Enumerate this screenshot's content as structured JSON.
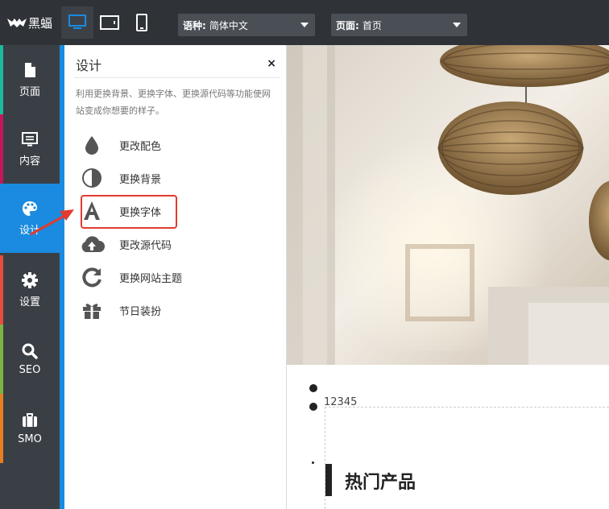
{
  "topbar": {
    "logo_text": "黑蝠",
    "device_buttons": [
      "desktop-icon",
      "tablet-icon",
      "phone-icon"
    ],
    "language": {
      "label": "语种:",
      "value": "简体中文"
    },
    "page": {
      "label": "页面:",
      "value": "首页"
    }
  },
  "leftnav": {
    "items": [
      {
        "label": "页面",
        "icon": "file-icon",
        "stripe": "#1abc9c"
      },
      {
        "label": "内容",
        "icon": "monitor-icon",
        "stripe": "#c2185b"
      },
      {
        "label": "设计",
        "icon": "palette-icon",
        "stripe": "#1a8be0"
      },
      {
        "label": "设置",
        "icon": "gear-icon",
        "stripe": "#e74c3c"
      },
      {
        "label": "SEO",
        "icon": "search-icon",
        "stripe": "#7cb342"
      },
      {
        "label": "SMO",
        "icon": "briefcase-icon",
        "stripe": "#e67e22"
      }
    ]
  },
  "panel": {
    "title": "设计",
    "close": "×",
    "description": "利用更换背景、更换字体、更换源代码等功能使网站变成你想要的样子。",
    "items": [
      {
        "label": "更改配色",
        "icon": "drop-icon"
      },
      {
        "label": "更换背景",
        "icon": "contrast-icon"
      },
      {
        "label": "更换字体",
        "icon": "font-icon"
      },
      {
        "label": "更改源代码",
        "icon": "cloud-upload-icon"
      },
      {
        "label": "更换网站主题",
        "icon": "refresh-icon"
      },
      {
        "label": "节日装扮",
        "icon": "gift-icon"
      }
    ]
  },
  "preview": {
    "number_text": "12345",
    "section_title": "热门产品"
  },
  "colors": {
    "accent": "#1a8be0",
    "topbar": "#2f3338",
    "nav": "#3a3f45",
    "highlight": "#e23b2e"
  }
}
